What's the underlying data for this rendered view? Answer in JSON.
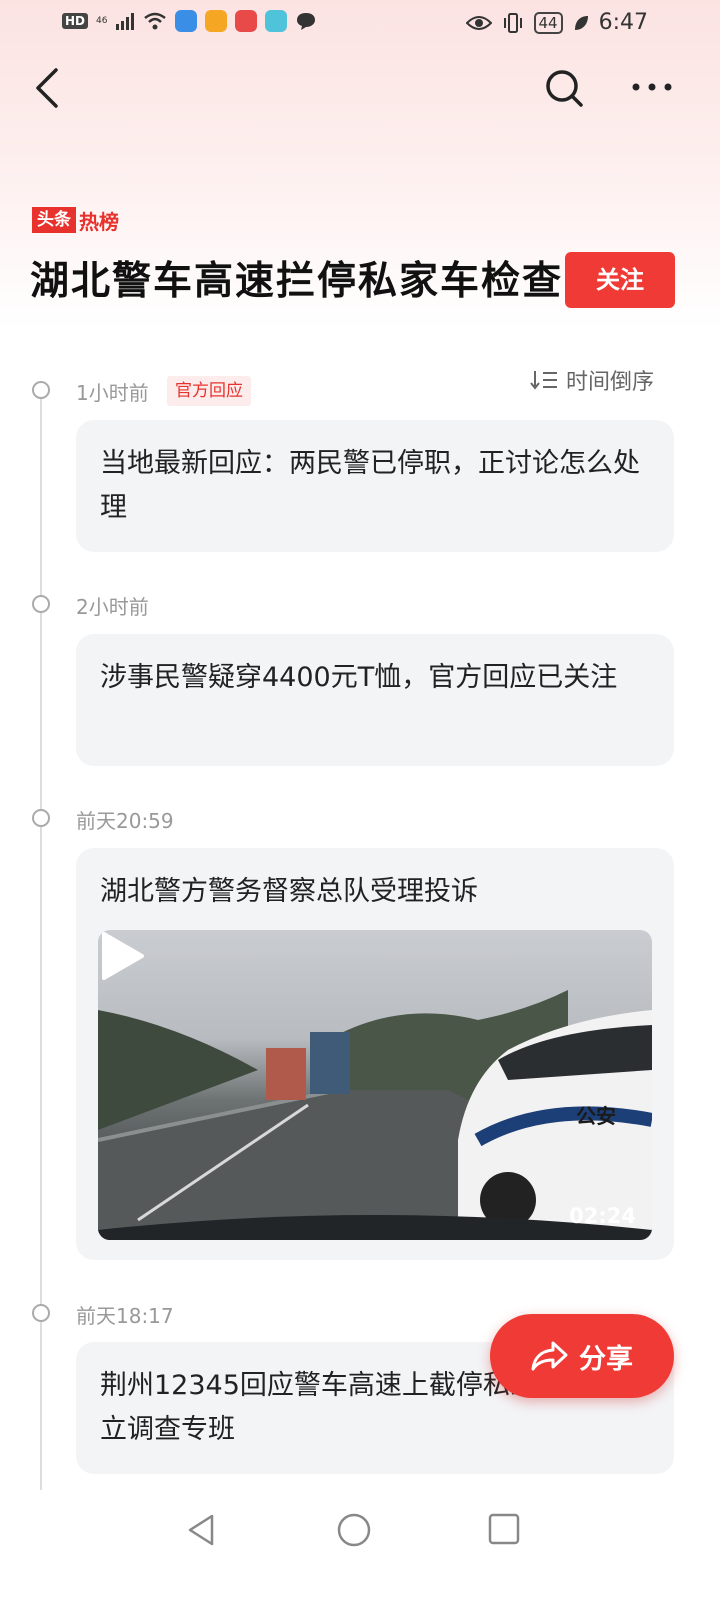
{
  "status_bar": {
    "hd": "HD",
    "signal": "46",
    "battery": "44",
    "time": "6:47"
  },
  "icons": {
    "back": "back-arrow-icon",
    "search": "search-icon",
    "more": "more-dots-icon",
    "sort": "sort-icon",
    "play": "play-icon",
    "share": "share-icon"
  },
  "header": {
    "tag_a": "头条",
    "tag_b": "热榜",
    "title": "湖北警车高速拦停私家车检查",
    "follow_label": "关注"
  },
  "sort": {
    "label": "时间倒序"
  },
  "timeline": [
    {
      "time": "1小时前",
      "badge": "官方回应",
      "text": "当地最新回应：两民警已停职，正讨论怎么处理"
    },
    {
      "time": "2小时前",
      "text": "涉事民警疑穿4400元T恤，官方回应已关注"
    },
    {
      "time": "前天20:59",
      "text": "湖北警方警务督察总队受理投诉",
      "video": {
        "duration": "02:24",
        "car_text": "公安"
      }
    },
    {
      "time": "前天18:17",
      "text": "荆州12345回应警车高速上截停私家车：已成立调查专班"
    }
  ],
  "share": {
    "label": "分享"
  },
  "colors": {
    "accent": "#ef3a35",
    "card_bg": "#f3f4f6",
    "muted": "#999999"
  }
}
